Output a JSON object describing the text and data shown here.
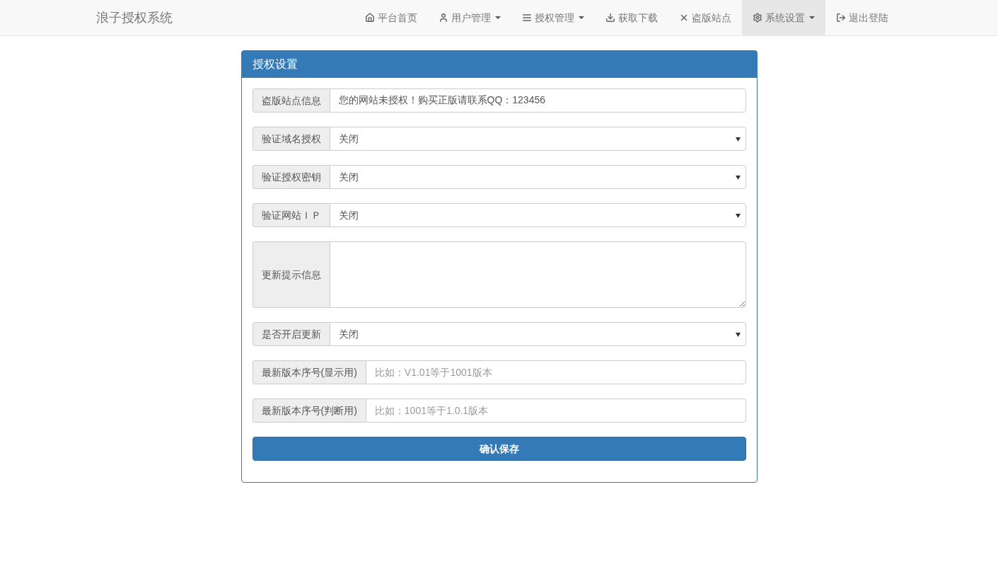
{
  "navbar": {
    "brand": "浪子授权系统",
    "items": [
      {
        "label": "平台首页",
        "dropdown": false,
        "selected": false
      },
      {
        "label": "用户管理",
        "dropdown": true,
        "selected": false
      },
      {
        "label": "授权管理",
        "dropdown": true,
        "selected": false
      },
      {
        "label": "获取下载",
        "dropdown": false,
        "selected": false
      },
      {
        "label": "盗版站点",
        "dropdown": false,
        "selected": false
      },
      {
        "label": "系统设置",
        "dropdown": true,
        "selected": true
      },
      {
        "label": "退出登陆",
        "dropdown": false,
        "selected": false
      }
    ]
  },
  "panel": {
    "title": "授权设置",
    "fields": [
      {
        "kind": "text",
        "label": "盗版站点信息",
        "value": "您的网站未授权！购买正版请联系QQ：123456"
      },
      {
        "kind": "select",
        "label": "验证域名授权",
        "value": "关闭"
      },
      {
        "kind": "select",
        "label": "验证授权密钥",
        "value": "关闭"
      },
      {
        "kind": "select",
        "label": "验证网站ＩＰ",
        "value": "关闭"
      },
      {
        "kind": "textarea",
        "label": "更新提示信息"
      },
      {
        "kind": "select",
        "label": "是否开启更新",
        "value": "关闭"
      },
      {
        "kind": "text",
        "label": "最新版本序号(显示用)",
        "placeholder": "比如：V1.01等于1001版本"
      },
      {
        "kind": "text",
        "label": "最新版本序号(判断用)",
        "placeholder": "比如：1001等于1.0.1版本"
      }
    ],
    "submit": "确认保存"
  }
}
